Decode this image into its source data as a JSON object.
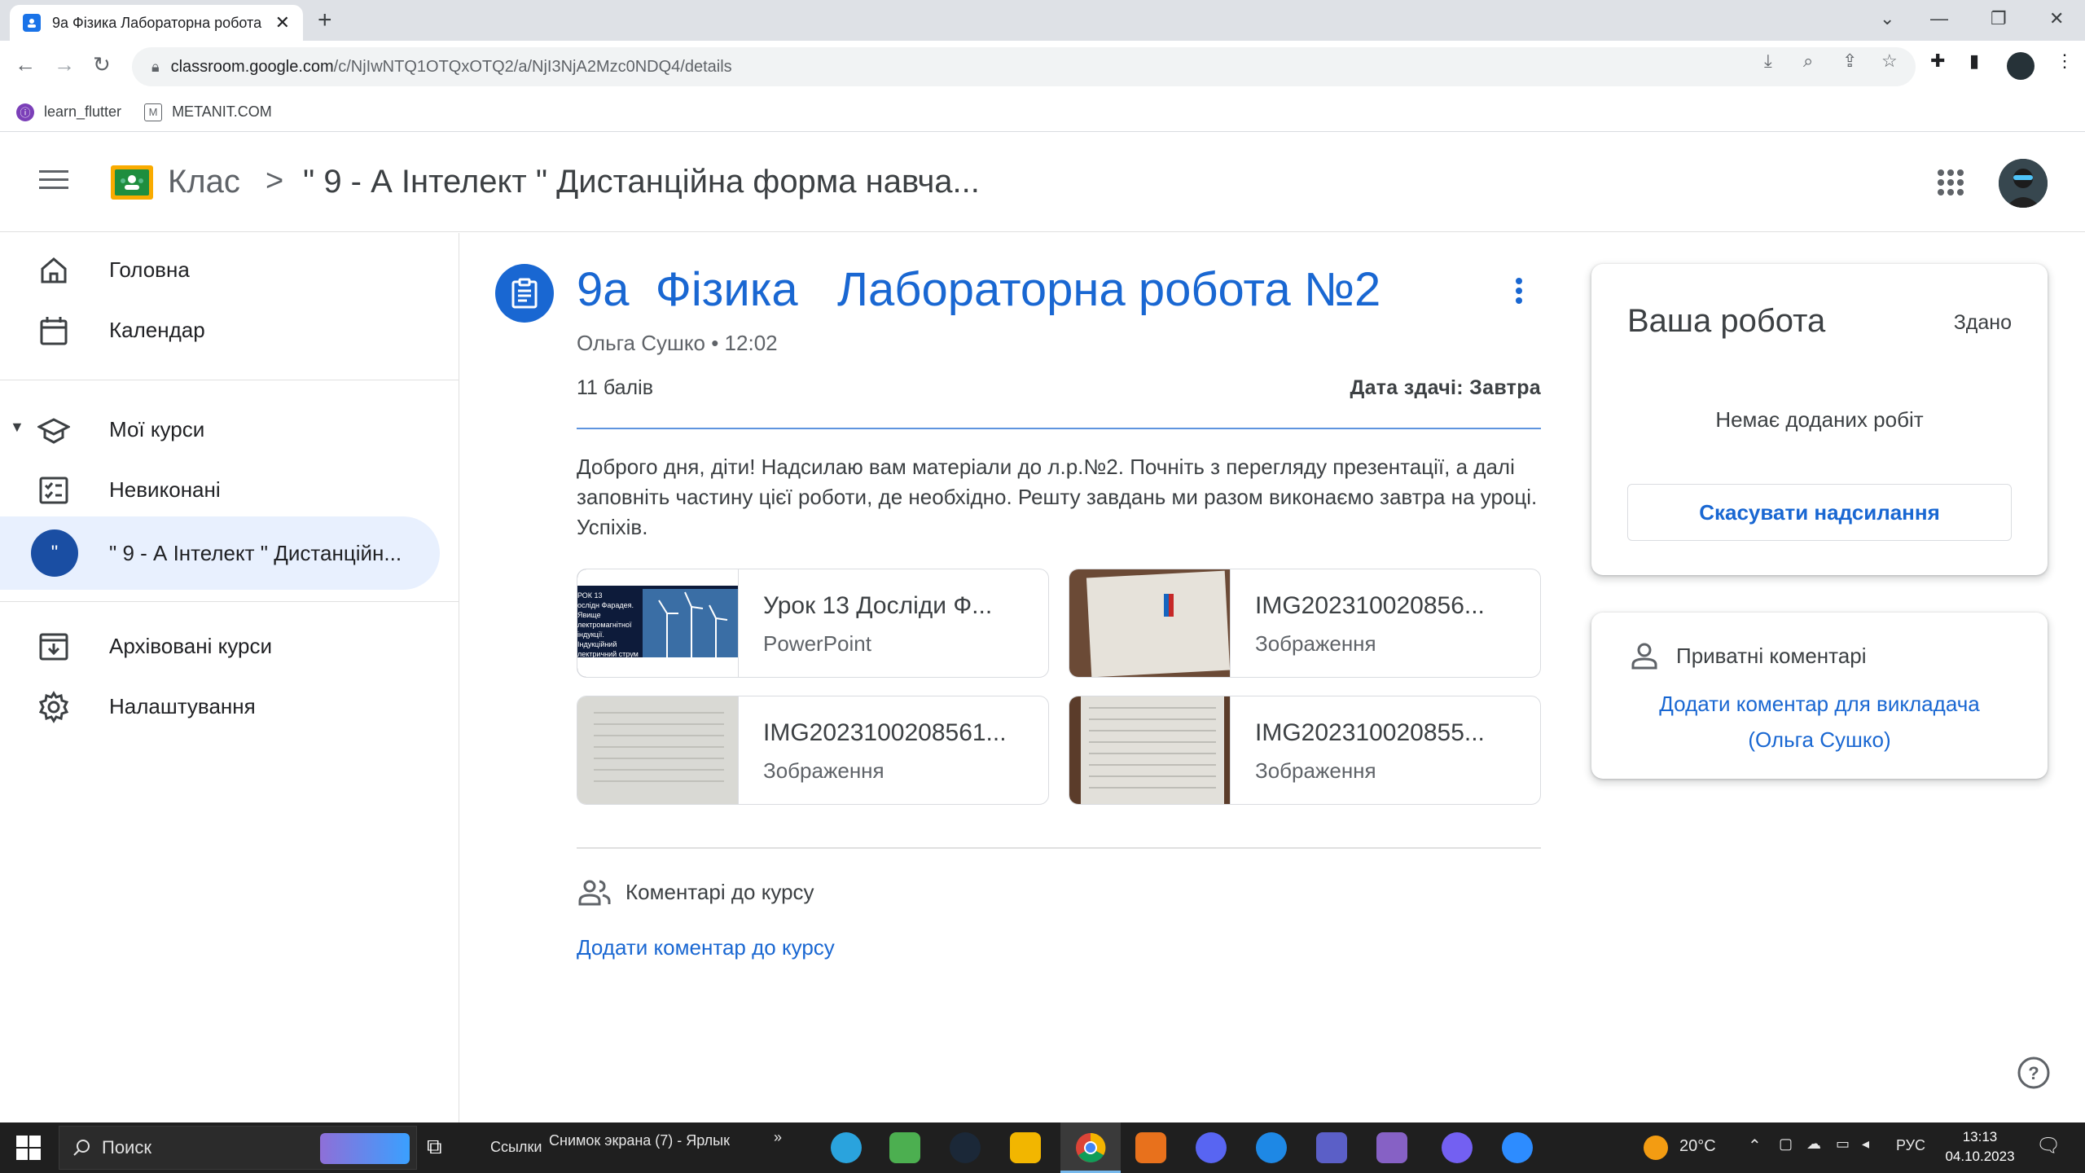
{
  "browser": {
    "tab_title": "9а Фізика Лабораторна робота",
    "tab_close": "✕",
    "new_tab": "+",
    "url_host": "classroom.google.com",
    "url_path": "/c/NjIwNTQ1OTQxOTQ2/a/NjI3NjA2Mzc0NDQ4/details",
    "bookmarks": [
      "learn_flutter",
      "METANIT.COM"
    ]
  },
  "header": {
    "app_name": "Клас",
    "separator": ">",
    "course_name": "\" 9 - А Інтелект \" Дистанційна форма навча..."
  },
  "sidebar": {
    "items": [
      {
        "label": "Головна",
        "icon": "home-icon"
      },
      {
        "label": "Календар",
        "icon": "calendar-icon"
      },
      {
        "label": "Мої курси",
        "icon": "school-icon"
      },
      {
        "label": "Невиконані",
        "icon": "todo-icon"
      },
      {
        "label": "\" 9 - А Інтелект \" Дистанційн...",
        "icon": "course-avatar",
        "avatar_text": "\""
      },
      {
        "label": "Архівовані курси",
        "icon": "archive-icon"
      },
      {
        "label": "Налаштування",
        "icon": "settings-icon"
      }
    ]
  },
  "assignment": {
    "title": "9а  Фізика   Лабораторна робота №2",
    "author_line": "Ольга Сушко • 12:02",
    "points": "11 балів",
    "due": "Дата здачі: Завтра",
    "description": "Доброго дня, діти! Надсилаю вам матеріали до л.р.№2. Почніть з перегляду презентації, а далі заповніть частину цієї роботи, де необхідно. Решту завдань ми разом виконаємо завтра на уроці. Успіхів.",
    "attachments": [
      {
        "name": "Урок 13 Досліди Ф...",
        "type": "PowerPoint",
        "thumb_text": "РОК 13\nослідн Фарадея.\nЯвище\nлектромагнітної\nіндукції.\nІндукційний\nлектричний струм"
      },
      {
        "name": "IMG202310020856...",
        "type": "Зображення"
      },
      {
        "name": "IMG2023100208561...",
        "type": "Зображення"
      },
      {
        "name": "IMG202310020855...",
        "type": "Зображення"
      }
    ],
    "class_comments_label": "Коментарі до курсу",
    "add_class_comment": "Додати коментар до курсу"
  },
  "your_work": {
    "title": "Ваша робота",
    "status": "Здано",
    "empty_text": "Немає доданих робіт",
    "unsubmit_label": "Скасувати надсилання"
  },
  "private_comments": {
    "label": "Приватні коментарі",
    "add_line1": "Додати коментар для викладача",
    "add_line2": "(Ольга Сушко)"
  },
  "taskbar": {
    "search_placeholder": "Поиск",
    "links_label": "Ссылки",
    "shortcut_label": "Снимок экрана (7) - Ярлык",
    "weather": "20°C",
    "language": "РУС",
    "time": "13:13",
    "date": "04.10.2023"
  },
  "colors": {
    "accent": "#1967d2",
    "active_nav_bg": "#e8f0fe",
    "chrome_tabstrip": "#dee1e6",
    "taskbar": "#1f1f1f"
  }
}
